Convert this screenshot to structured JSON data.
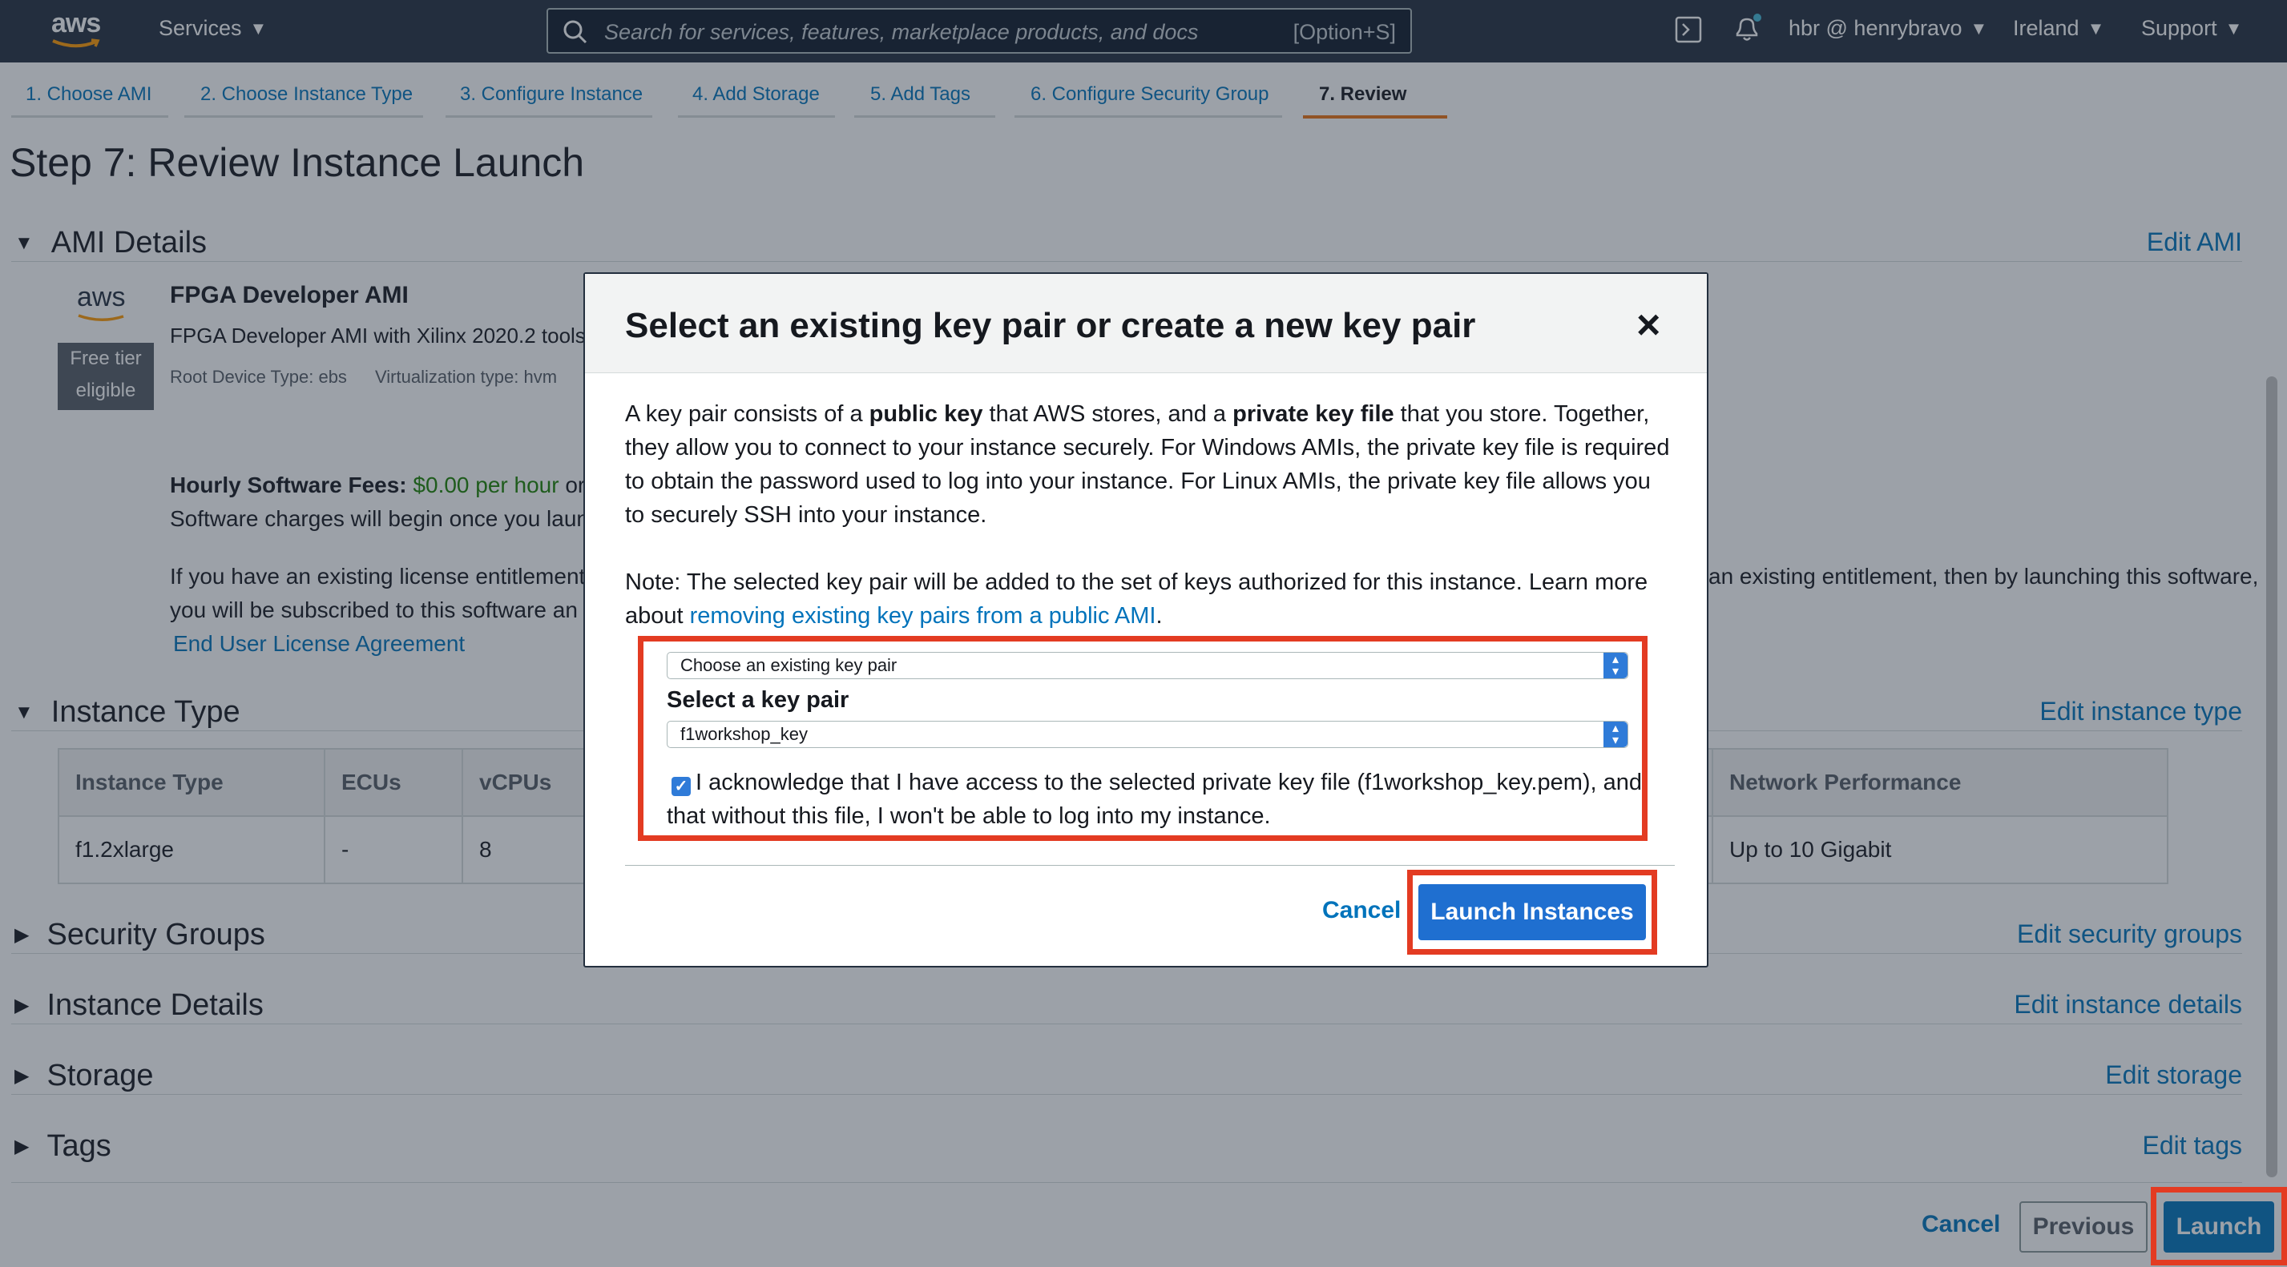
{
  "nav": {
    "logo": "aws",
    "services": "Services",
    "search_placeholder": "Search for services, features, marketplace products, and docs",
    "search_shortcut": "[Option+S]",
    "account": "hbr @ henrybravo",
    "region": "Ireland",
    "support": "Support"
  },
  "tabs": [
    {
      "label": "1. Choose AMI"
    },
    {
      "label": "2. Choose Instance Type"
    },
    {
      "label": "3. Configure Instance"
    },
    {
      "label": "4. Add Storage"
    },
    {
      "label": "5. Add Tags"
    },
    {
      "label": "6. Configure Security Group"
    },
    {
      "label": "7. Review"
    }
  ],
  "page_title": "Step 7: Review Instance Launch",
  "ami": {
    "section": "AMI Details",
    "edit": "Edit AMI",
    "logo": "aws",
    "free_tier_line1": "Free tier",
    "free_tier_line2": "eligible",
    "name": "FPGA Developer AMI",
    "description": "FPGA Developer AMI with Xilinx 2020.2 tools",
    "root_device": "Root Device Type: ebs",
    "virtualization": "Virtualization type: hvm",
    "fees_label": "Hourly Software Fees:",
    "fees_value": "$0.00 per hour",
    "fees_suffix": "or",
    "charges": "Software charges will begin once you laun",
    "license_line1_left": "If you have an existing license entitlement",
    "license_line1_right": "an existing entitlement, then by launching this software,",
    "license_line2": "you will be subscribed to this software an",
    "eula": "End User License Agreement"
  },
  "instance_type": {
    "section": "Instance Type",
    "edit": "Edit instance type",
    "headers": [
      "Instance Type",
      "ECUs",
      "vCPUs",
      "Network Performance"
    ],
    "row": [
      "f1.2xlarge",
      "-",
      "8",
      "Up to 10 Gigabit"
    ]
  },
  "sections": [
    {
      "title": "Security Groups",
      "edit": "Edit security groups"
    },
    {
      "title": "Instance Details",
      "edit": "Edit instance details"
    },
    {
      "title": "Storage",
      "edit": "Edit storage"
    },
    {
      "title": "Tags",
      "edit": "Edit tags"
    }
  ],
  "footer": {
    "cancel": "Cancel",
    "previous": "Previous",
    "launch": "Launch"
  },
  "modal": {
    "title": "Select an existing key pair or create a new key pair",
    "close": "×",
    "p1_a": "A key pair consists of a ",
    "p1_b": "public key",
    "p1_c": " that AWS stores, and a ",
    "p1_d": "private key file",
    "p1_e": " that you store. Together, they allow you to connect to your instance securely. For Windows AMIs, the private key file is required to obtain the password used to log into your instance. For Linux AMIs, the private key file allows you to securely SSH into your instance.",
    "note_a": "Note: The selected key pair will be added to the set of keys authorized for this instance. Learn more about ",
    "note_link": "removing existing key pairs from a public AMI",
    "note_end": ".",
    "mode_select": "Choose an existing key pair",
    "keypair_label": "Select a key pair",
    "keypair_select": "f1workshop_key",
    "ack_checked": true,
    "ack_text": "I acknowledge that I have access to the selected private key file (f1workshop_key.pem), and that without this file, I won't be able to log into my instance.",
    "cancel": "Cancel",
    "launch": "Launch Instances"
  },
  "colors": {
    "nav_bg": "#232f3e",
    "link": "#0073bb",
    "accent_orange": "#ec7211",
    "highlight_red": "#e33b22",
    "primary_button": "#1f6fd0",
    "price_green": "#1d8102"
  }
}
